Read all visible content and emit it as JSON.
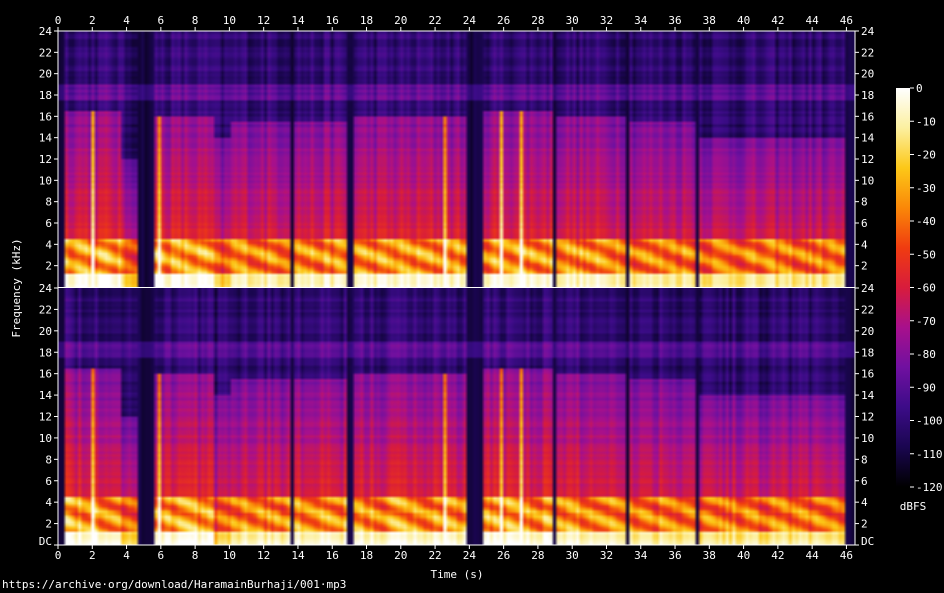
{
  "chart_data": {
    "type": "heatmap",
    "xlabel": "Time (s)",
    "ylabel": "Frequency (kHz)",
    "x_ticks": [
      0,
      2,
      4,
      6,
      8,
      10,
      12,
      14,
      16,
      18,
      20,
      22,
      24,
      26,
      28,
      30,
      32,
      34,
      36,
      38,
      40,
      42,
      44,
      46
    ],
    "xlim": [
      0,
      46.5
    ],
    "y_ticks": [
      {
        "value": 0,
        "label": "DC"
      },
      {
        "value": 2,
        "label": "2"
      },
      {
        "value": 4,
        "label": "4"
      },
      {
        "value": 6,
        "label": "6"
      },
      {
        "value": 8,
        "label": "8"
      },
      {
        "value": 10,
        "label": "10"
      },
      {
        "value": 12,
        "label": "12"
      },
      {
        "value": 14,
        "label": "14"
      },
      {
        "value": 16,
        "label": "16"
      },
      {
        "value": 18,
        "label": "18"
      },
      {
        "value": 20,
        "label": "20"
      },
      {
        "value": 22,
        "label": "22"
      },
      {
        "value": 24,
        "label": "24"
      }
    ],
    "ylim": [
      0,
      24
    ],
    "channels": [
      "upper",
      "lower"
    ],
    "colorbar": {
      "label": "dBFS",
      "range": [
        -120,
        0
      ],
      "ticks": [
        0,
        -10,
        -20,
        -30,
        -40,
        -50,
        -60,
        -70,
        -80,
        -90,
        -100,
        -110,
        -120
      ],
      "colors": [
        "#000000",
        "#1a0650",
        "#3c0c88",
        "#7010a0",
        "#a8108c",
        "#d81c3c",
        "#f03c10",
        "#fa8808",
        "#fcc818",
        "#fcf0a0",
        "#ffffff"
      ]
    },
    "segments": [
      {
        "start": 0.3,
        "end": 3.6,
        "top_khz": 16.5,
        "intensity": 0.85
      },
      {
        "start": 3.6,
        "end": 4.6,
        "top_khz": 12,
        "intensity": 0.45
      },
      {
        "start": 5.6,
        "end": 9.2,
        "top_khz": 16,
        "intensity": 0.82
      },
      {
        "start": 9.2,
        "end": 10.0,
        "top_khz": 14,
        "intensity": 0.4
      },
      {
        "start": 10.1,
        "end": 13.5,
        "top_khz": 15.5,
        "intensity": 0.7
      },
      {
        "start": 13.7,
        "end": 16.8,
        "top_khz": 15.5,
        "intensity": 0.72
      },
      {
        "start": 17.2,
        "end": 23.8,
        "top_khz": 16,
        "intensity": 0.75
      },
      {
        "start": 24.8,
        "end": 28.8,
        "top_khz": 16.5,
        "intensity": 0.8
      },
      {
        "start": 29.0,
        "end": 33.2,
        "top_khz": 16,
        "intensity": 0.72
      },
      {
        "start": 33.4,
        "end": 37.2,
        "top_khz": 15.5,
        "intensity": 0.65
      },
      {
        "start": 37.4,
        "end": 46.0,
        "top_khz": 14,
        "intensity": 0.6
      }
    ],
    "spikes": [
      2.0,
      5.9,
      22.5,
      25.8,
      27.0
    ]
  },
  "source_url": "https://archive·org/download/HaramainBurhaji/001·mp3"
}
